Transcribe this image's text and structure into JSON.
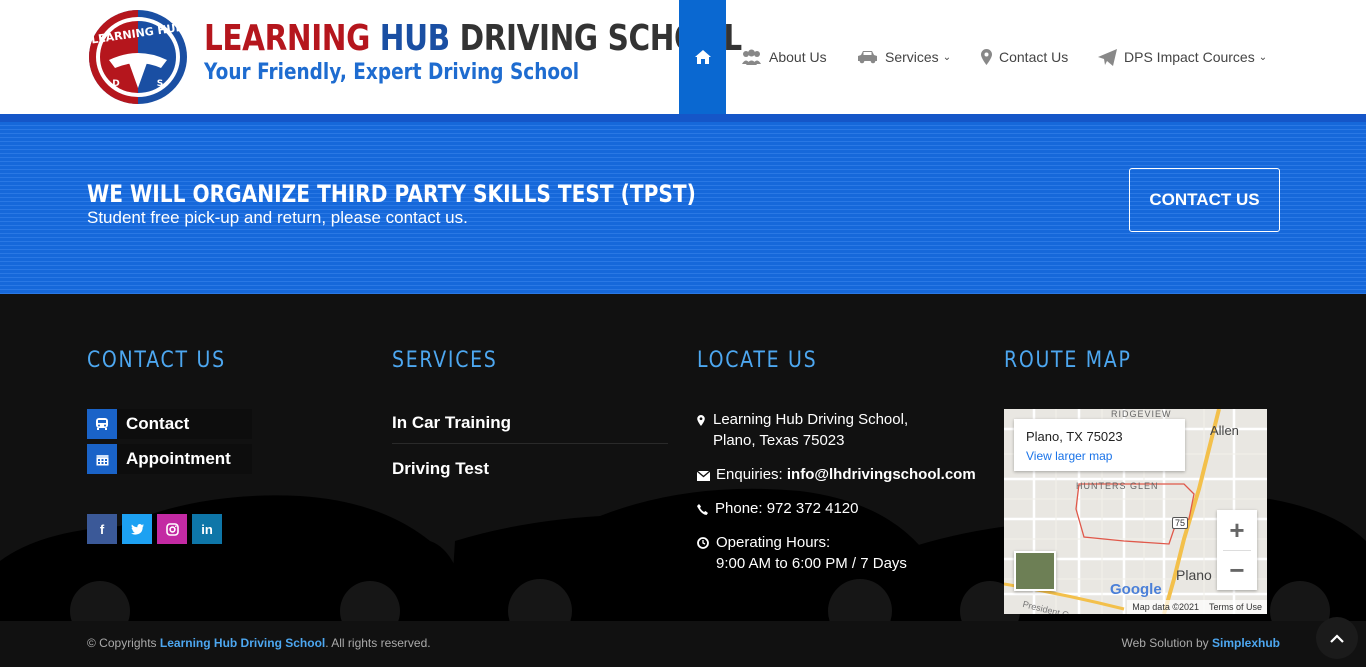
{
  "header": {
    "logo_text": "LEARNING HUB",
    "logo_letters": [
      "D",
      "S"
    ],
    "brand": {
      "w1": "LEARNING",
      "w2": "HUB",
      "w3": "DRIVING SCHOOL"
    },
    "tagline": "Your Friendly, Expert Driving School",
    "nav": [
      {
        "label": "About Us",
        "icon": "users-icon"
      },
      {
        "label": "Services",
        "icon": "car-icon",
        "dropdown": true
      },
      {
        "label": "Contact Us",
        "icon": "map-marker-icon"
      },
      {
        "label": "DPS Impact Cources",
        "icon": "paper-plane-icon",
        "dropdown": true
      }
    ],
    "caret": "⌄"
  },
  "banner": {
    "title": "WE WILL ORGANIZE THIRD PARTY SKILLS TEST (TPST)",
    "subtitle": "Student free pick-up and return, please contact us.",
    "cta": "CONTACT US"
  },
  "footer": {
    "contact": {
      "heading": "CONTACT US",
      "buttons": [
        {
          "label": "Contact",
          "icon": "bus-icon"
        },
        {
          "label": "Appointment",
          "icon": "calendar-icon"
        }
      ],
      "social": [
        {
          "label": "f",
          "icon": "facebook-icon",
          "color": "#3b5998"
        },
        {
          "label": "t",
          "icon": "twitter-icon",
          "color": "#1da1f2"
        },
        {
          "label": "ig",
          "icon": "instagram-icon",
          "color": "#c32aa3"
        },
        {
          "label": "in",
          "icon": "linkedin-icon",
          "color": "#0e76a8"
        }
      ]
    },
    "services": {
      "heading": "SERVICES",
      "items": [
        "In Car Training",
        "Driving Test"
      ]
    },
    "locate": {
      "heading": "LOCATE US",
      "address_line1": "Learning Hub Driving School,",
      "address_line2": "Plano, Texas 75023",
      "enquiries_label": "Enquiries:",
      "email": "info@lhdrivingschool.com",
      "phone": "Phone: 972 372 4120",
      "hours_label": "Operating Hours:",
      "hours": "9:00 AM to 6:00 PM / 7 Days"
    },
    "route": {
      "heading": "ROUTE MAP",
      "map_title": "Plano, TX 75023",
      "map_link": "View larger map",
      "labels": {
        "ridgeview": "RIDGEVIEW",
        "allen": "Allen",
        "hunters_glen": "HUNTERS GLEN",
        "plano": "Plano",
        "highway": "75",
        "president": "President Ge"
      },
      "google": "Google",
      "map_data": "Map data ©2021",
      "terms": "Terms of Use",
      "zoom_in": "+",
      "zoom_out": "−"
    }
  },
  "bottom": {
    "copy_prefix": "© Copyrights",
    "copy_link": "Learning Hub Driving School",
    "copy_suffix": ". All rights reserved.",
    "credit_prefix": "Web Solution by",
    "credit_link": "Simplexhub"
  },
  "colors": {
    "primary_blue": "#0a68d1",
    "brand_red": "#b5161d",
    "heading_blue": "#4da7f0"
  }
}
